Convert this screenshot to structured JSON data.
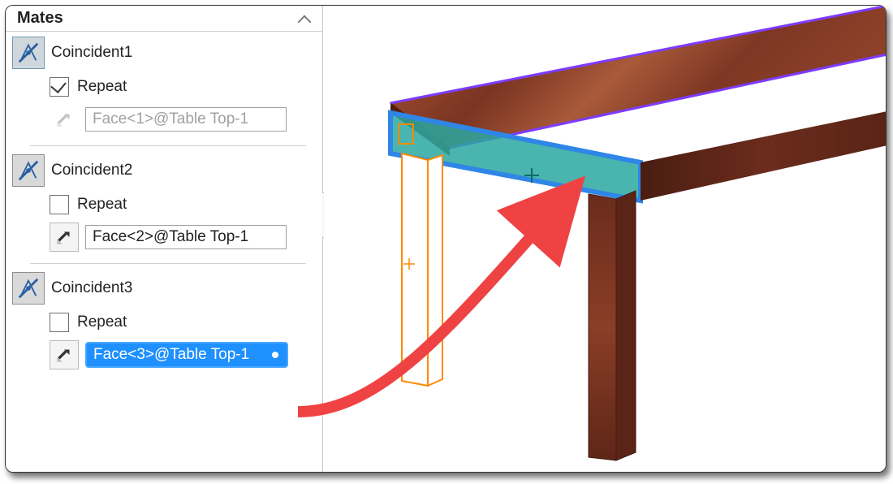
{
  "panel": {
    "title": "Mates",
    "mates": [
      {
        "name": "Coincident1",
        "repeat_label": "Repeat",
        "repeat_checked": true,
        "face_value": "Face<1>@Table Top-1",
        "face_enabled": false,
        "swap_enabled": false,
        "selected": false
      },
      {
        "name": "Coincident2",
        "repeat_label": "Repeat",
        "repeat_checked": false,
        "face_value": "Face<2>@Table Top-1",
        "face_enabled": true,
        "swap_enabled": true,
        "selected": false
      },
      {
        "name": "Coincident3",
        "repeat_label": "Repeat",
        "repeat_checked": false,
        "face_value": "Face<3>@Table Top-1",
        "face_enabled": true,
        "swap_enabled": true,
        "selected": true
      }
    ]
  },
  "colors": {
    "selection_fill": "#1e90ff",
    "highlight_face": "#2aa7a0",
    "highlight_edge": "#2f86e6",
    "arrow": "#ef4343"
  }
}
